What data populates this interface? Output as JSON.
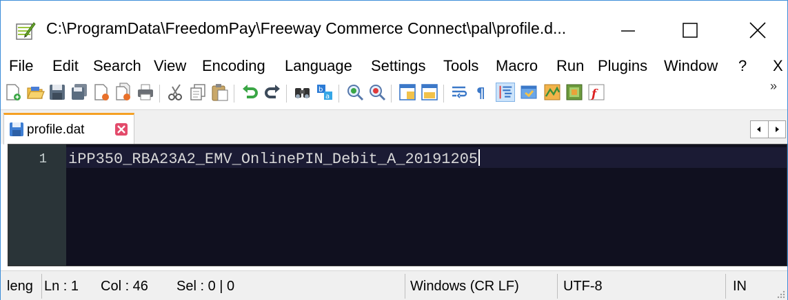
{
  "window": {
    "title": "C:\\ProgramData\\FreedomPay\\Freeway Commerce Connect\\pal\\profile.d...",
    "controls": {
      "minimize_icon": "minimize-icon",
      "maximize_icon": "maximize-icon",
      "close_icon": "close-icon"
    }
  },
  "menu": {
    "items": [
      "File",
      "Edit",
      "Search",
      "View",
      "Encoding",
      "Language",
      "Settings",
      "Tools",
      "Macro",
      "Run",
      "Plugins",
      "Window",
      "?",
      "X"
    ]
  },
  "toolbar": {
    "overflow": "»",
    "icons": [
      "new-file-icon",
      "open-file-icon",
      "save-icon",
      "save-all-icon",
      "close-icon",
      "close-all-icon",
      "print-icon",
      "cut-icon",
      "copy-icon",
      "paste-icon",
      "undo-icon",
      "redo-icon",
      "find-icon",
      "replace-icon",
      "zoom-in-icon",
      "zoom-out-icon",
      "sync-vertical-icon",
      "sync-horizontal-icon",
      "word-wrap-icon",
      "show-all-chars-icon",
      "indent-guide-icon",
      "user-defined-language-icon",
      "document-map-icon",
      "function-list-icon",
      "macro-record-icon"
    ]
  },
  "tabs": [
    {
      "label": "profile.dat",
      "active": true
    }
  ],
  "editor": {
    "line_number": "1",
    "line_text": "iPP350_RBA23A2_EMV_OnlinePIN_Debit_A_20191205"
  },
  "status": {
    "length": "leng",
    "line": "Ln : 1",
    "col": "Col : 46",
    "sel": "Sel : 0 | 0",
    "eol": "Windows (CR LF)",
    "encoding": "UTF-8",
    "mode": "IN"
  },
  "colors": {
    "editor_bg": "#10101f",
    "gutter_bg": "#2a3438",
    "tab_accent": "#f5a023",
    "window_border": "#3c8dd9"
  }
}
